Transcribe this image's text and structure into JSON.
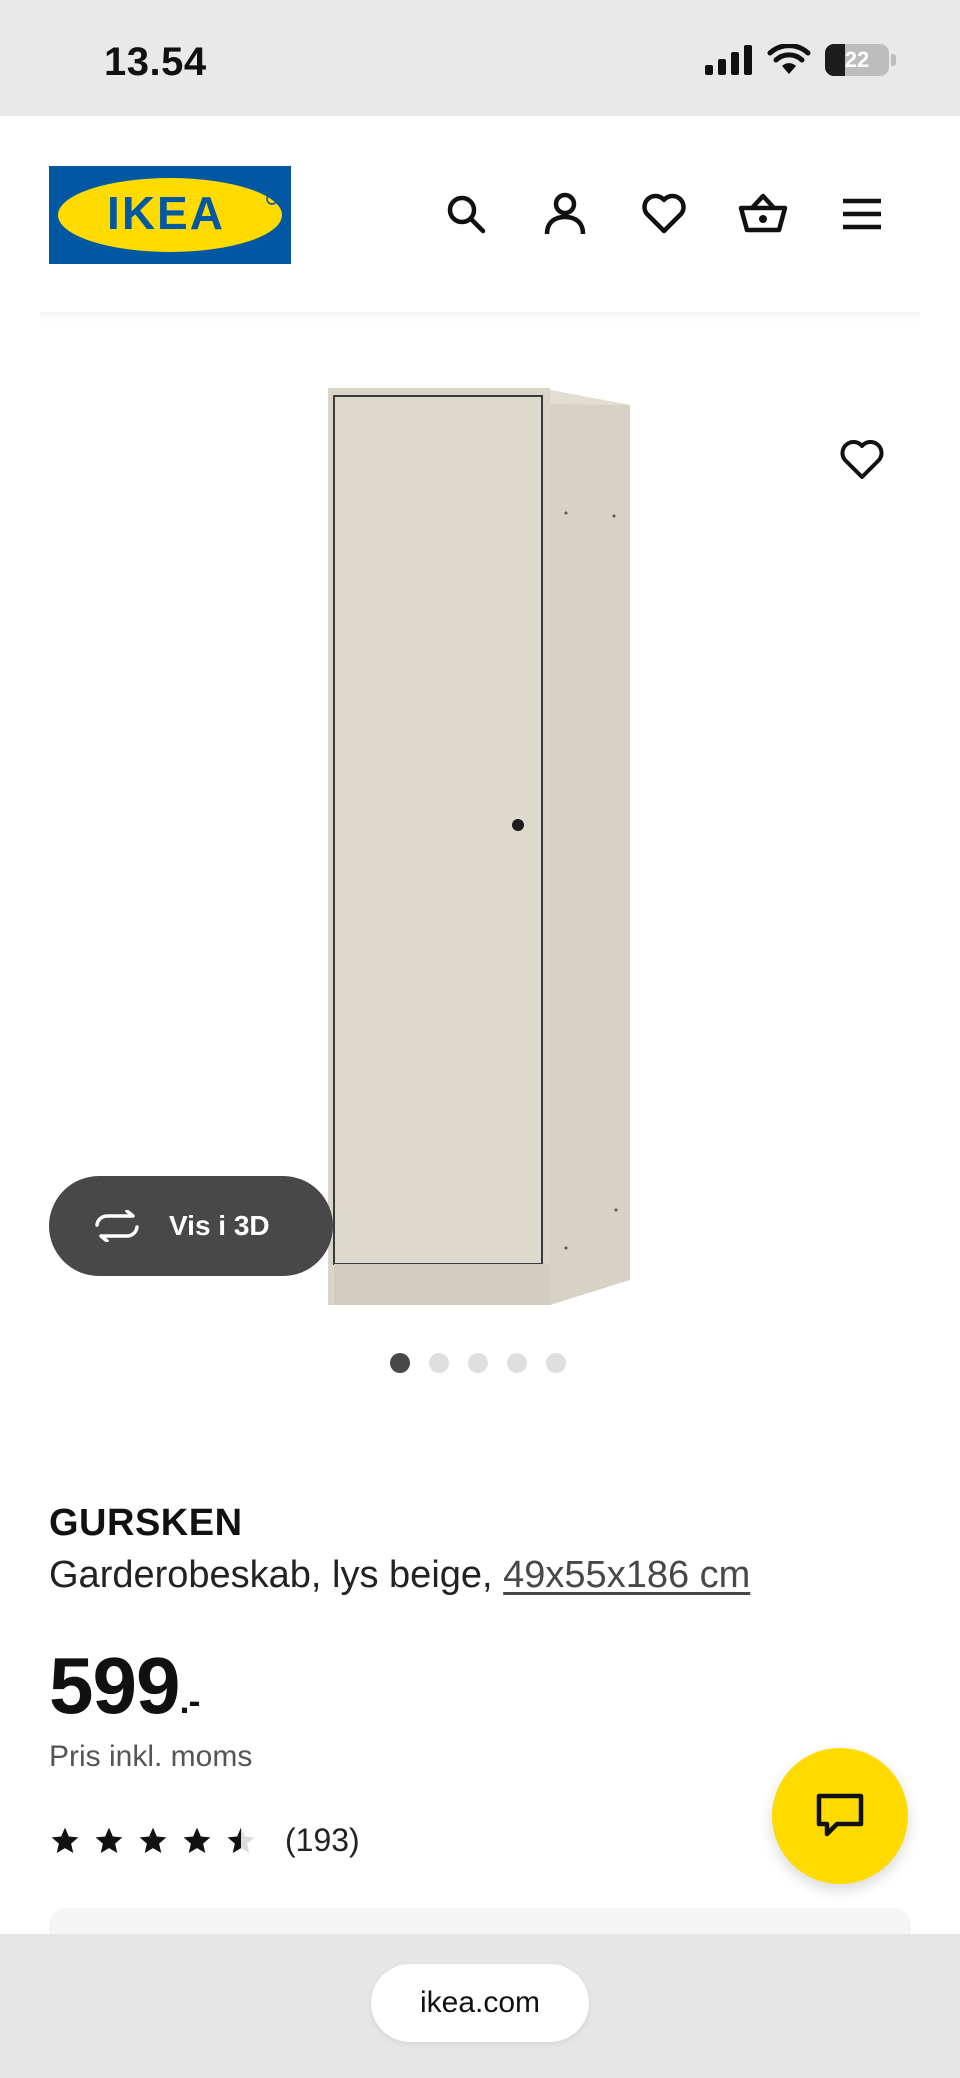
{
  "status_bar": {
    "time": "13.54",
    "battery_level": "22"
  },
  "header": {
    "logo_text": "IKEA",
    "brand_colors": {
      "blue": "#0058a3",
      "yellow": "#ffdb00"
    },
    "icons": [
      "search-icon",
      "account-icon",
      "heart-icon",
      "basket-icon",
      "menu-icon"
    ]
  },
  "hero": {
    "view_3d_label": "Vis i 3D",
    "carousel": {
      "total": 5,
      "active_index": 0
    }
  },
  "product": {
    "brand": "GURSKEN",
    "description": "Garderobeskab, lys beige,",
    "dimensions": "49x55x186 cm",
    "price": "599",
    "price_suffix": ".-",
    "price_note": "Pris inkl. moms",
    "rating": {
      "stars": 4.5,
      "max": 5,
      "count": "(193)"
    }
  },
  "browser": {
    "url": "ikea.com"
  }
}
